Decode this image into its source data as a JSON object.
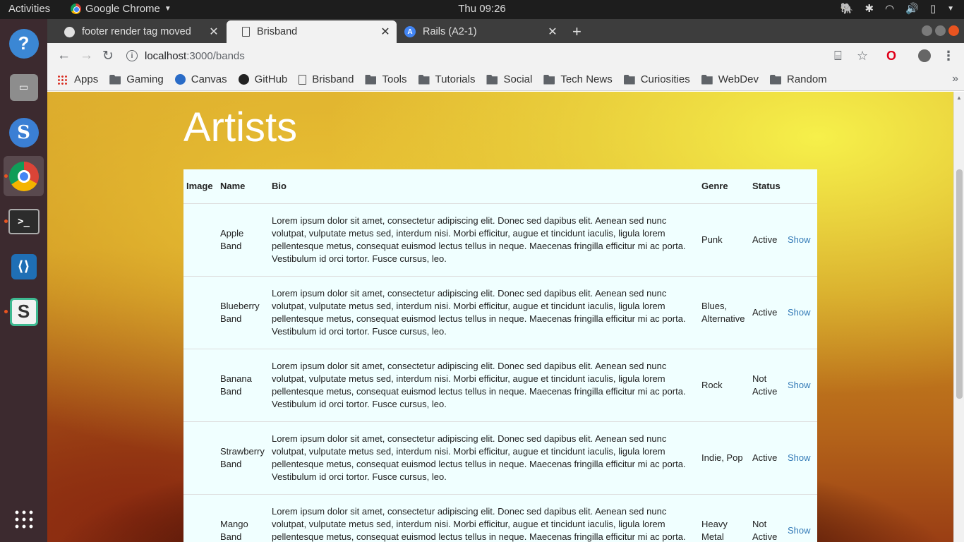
{
  "os_topbar": {
    "activities": "Activities",
    "app_name": "Google Chrome",
    "clock": "Thu 09:26"
  },
  "browser": {
    "tabs": [
      {
        "title": "footer render tag moved",
        "icon": "github-icon",
        "active": false
      },
      {
        "title": "Brisband",
        "icon": "page-icon",
        "active": true
      },
      {
        "title": "Rails (A2-1)",
        "icon": "canvas-icon",
        "active": false
      }
    ],
    "url_host": "localhost",
    "url_path": ":3000/bands",
    "bookmarks": [
      {
        "label": "Apps",
        "icon": "apps-grid-icon"
      },
      {
        "label": "Gaming",
        "icon": "folder-icon"
      },
      {
        "label": "Canvas",
        "icon": "canvas-icon"
      },
      {
        "label": "GitHub",
        "icon": "github-icon"
      },
      {
        "label": "Brisband",
        "icon": "page-icon"
      },
      {
        "label": "Tools",
        "icon": "folder-icon"
      },
      {
        "label": "Tutorials",
        "icon": "folder-icon"
      },
      {
        "label": "Social",
        "icon": "folder-icon"
      },
      {
        "label": "Tech News",
        "icon": "folder-icon"
      },
      {
        "label": "Curiosities",
        "icon": "folder-icon"
      },
      {
        "label": "WebDev",
        "icon": "folder-icon"
      },
      {
        "label": "Random",
        "icon": "folder-icon"
      }
    ]
  },
  "page": {
    "title": "Artists",
    "table": {
      "headers": {
        "image": "Image",
        "name": "Name",
        "bio": "Bio",
        "genre": "Genre",
        "status": "Status"
      },
      "rows": [
        {
          "name": "Apple Band",
          "bio": "Lorem ipsum dolor sit amet, consectetur adipiscing elit. Donec sed dapibus elit. Aenean sed nunc volutpat, vulputate metus sed, interdum nisi. Morbi efficitur, augue et tincidunt iaculis, ligula lorem pellentesque metus, consequat euismod lectus tellus in neque. Maecenas fringilla efficitur mi ac porta. Vestibulum id orci tortor. Fusce cursus, leo.",
          "genre": "Punk",
          "status": "Active",
          "action": "Show"
        },
        {
          "name": "Blueberry Band",
          "bio": "Lorem ipsum dolor sit amet, consectetur adipiscing elit. Donec sed dapibus elit. Aenean sed nunc volutpat, vulputate metus sed, interdum nisi. Morbi efficitur, augue et tincidunt iaculis, ligula lorem pellentesque metus, consequat euismod lectus tellus in neque. Maecenas fringilla efficitur mi ac porta. Vestibulum id orci tortor. Fusce cursus, leo.",
          "genre": "Blues, Alternative",
          "status": "Active",
          "action": "Show"
        },
        {
          "name": "Banana Band",
          "bio": "Lorem ipsum dolor sit amet, consectetur adipiscing elit. Donec sed dapibus elit. Aenean sed nunc volutpat, vulputate metus sed, interdum nisi. Morbi efficitur, augue et tincidunt iaculis, ligula lorem pellentesque metus, consequat euismod lectus tellus in neque. Maecenas fringilla efficitur mi ac porta. Vestibulum id orci tortor. Fusce cursus, leo.",
          "genre": "Rock",
          "status": "Not Active",
          "action": "Show"
        },
        {
          "name": "Strawberry Band",
          "bio": "Lorem ipsum dolor sit amet, consectetur adipiscing elit. Donec sed dapibus elit. Aenean sed nunc volutpat, vulputate metus sed, interdum nisi. Morbi efficitur, augue et tincidunt iaculis, ligula lorem pellentesque metus, consequat euismod lectus tellus in neque. Maecenas fringilla efficitur mi ac porta. Vestibulum id orci tortor. Fusce cursus, leo.",
          "genre": "Indie, Pop",
          "status": "Active",
          "action": "Show"
        },
        {
          "name": "Mango Band",
          "bio": "Lorem ipsum dolor sit amet, consectetur adipiscing elit. Donec sed dapibus elit. Aenean sed nunc volutpat, vulputate metus sed, interdum nisi. Morbi efficitur, augue et tincidunt iaculis, ligula lorem pellentesque metus, consequat euismod lectus tellus in neque. Maecenas fringilla efficitur mi ac porta. Vestibulum id orci tortor. Fusce cursus, leo.",
          "genre": "Heavy Metal",
          "status": "Not Active",
          "action": "Show"
        }
      ]
    }
  },
  "dock": {
    "items": [
      "help-icon",
      "files-icon",
      "simplenote-icon",
      "chrome-icon",
      "terminal-icon",
      "vscode-icon",
      "slack-icon",
      "show-apps-icon"
    ]
  },
  "colors": {
    "link": "#337ab7",
    "table_bg": "#f0ffff",
    "accent": "#e95420"
  }
}
